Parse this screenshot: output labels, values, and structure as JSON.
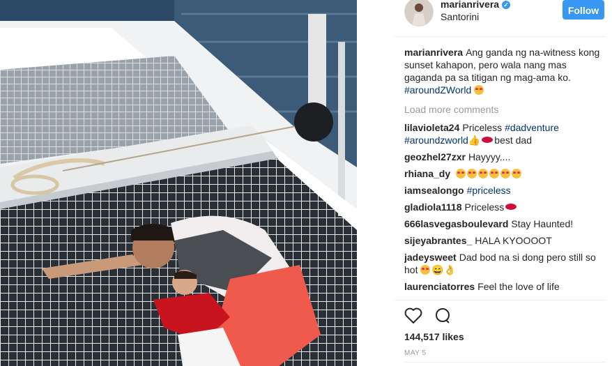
{
  "post": {
    "username": "marianrivera",
    "location": "Santorini",
    "follow_label": "Follow",
    "caption_user": "marianrivera",
    "caption_text": "Ang ganda ng na-witness kong sunset kahapon, pero wala nang mas gaganda pa sa titigan ng mag-ama ko.",
    "caption_tag": "#aroundZWorld",
    "load_more": "Load more comments",
    "likes": "144,517 likes",
    "date": "MAY 5"
  },
  "comments": [
    {
      "user": "lilavioleta24",
      "text": "Priceless",
      "tag": "#dadventure",
      "tag2": "#aroundzworld",
      "text2": "best dad"
    },
    {
      "user": "geozhel27zxr",
      "text": "Hayyyy...."
    },
    {
      "user": "rhiana_dy",
      "text": ""
    },
    {
      "user": "iamsealongo",
      "tag": "#priceless"
    },
    {
      "user": "gladiola1118",
      "text": "Priceless"
    },
    {
      "user": "666lasvegasboulevard",
      "text": "Stay Haunted!"
    },
    {
      "user": "sijeyabrantes_",
      "text": "HALA KYOOOOT"
    },
    {
      "user": "jadeysweet",
      "text": "Dad bod na si dong pero still so hot"
    },
    {
      "user": "laurenciatorres",
      "text": "Feel the love of life"
    }
  ],
  "icons": [
    "heart-icon",
    "comment-icon",
    "verified-icon"
  ],
  "colors": {
    "accent": "#3897f0",
    "hashtag": "#003569"
  }
}
